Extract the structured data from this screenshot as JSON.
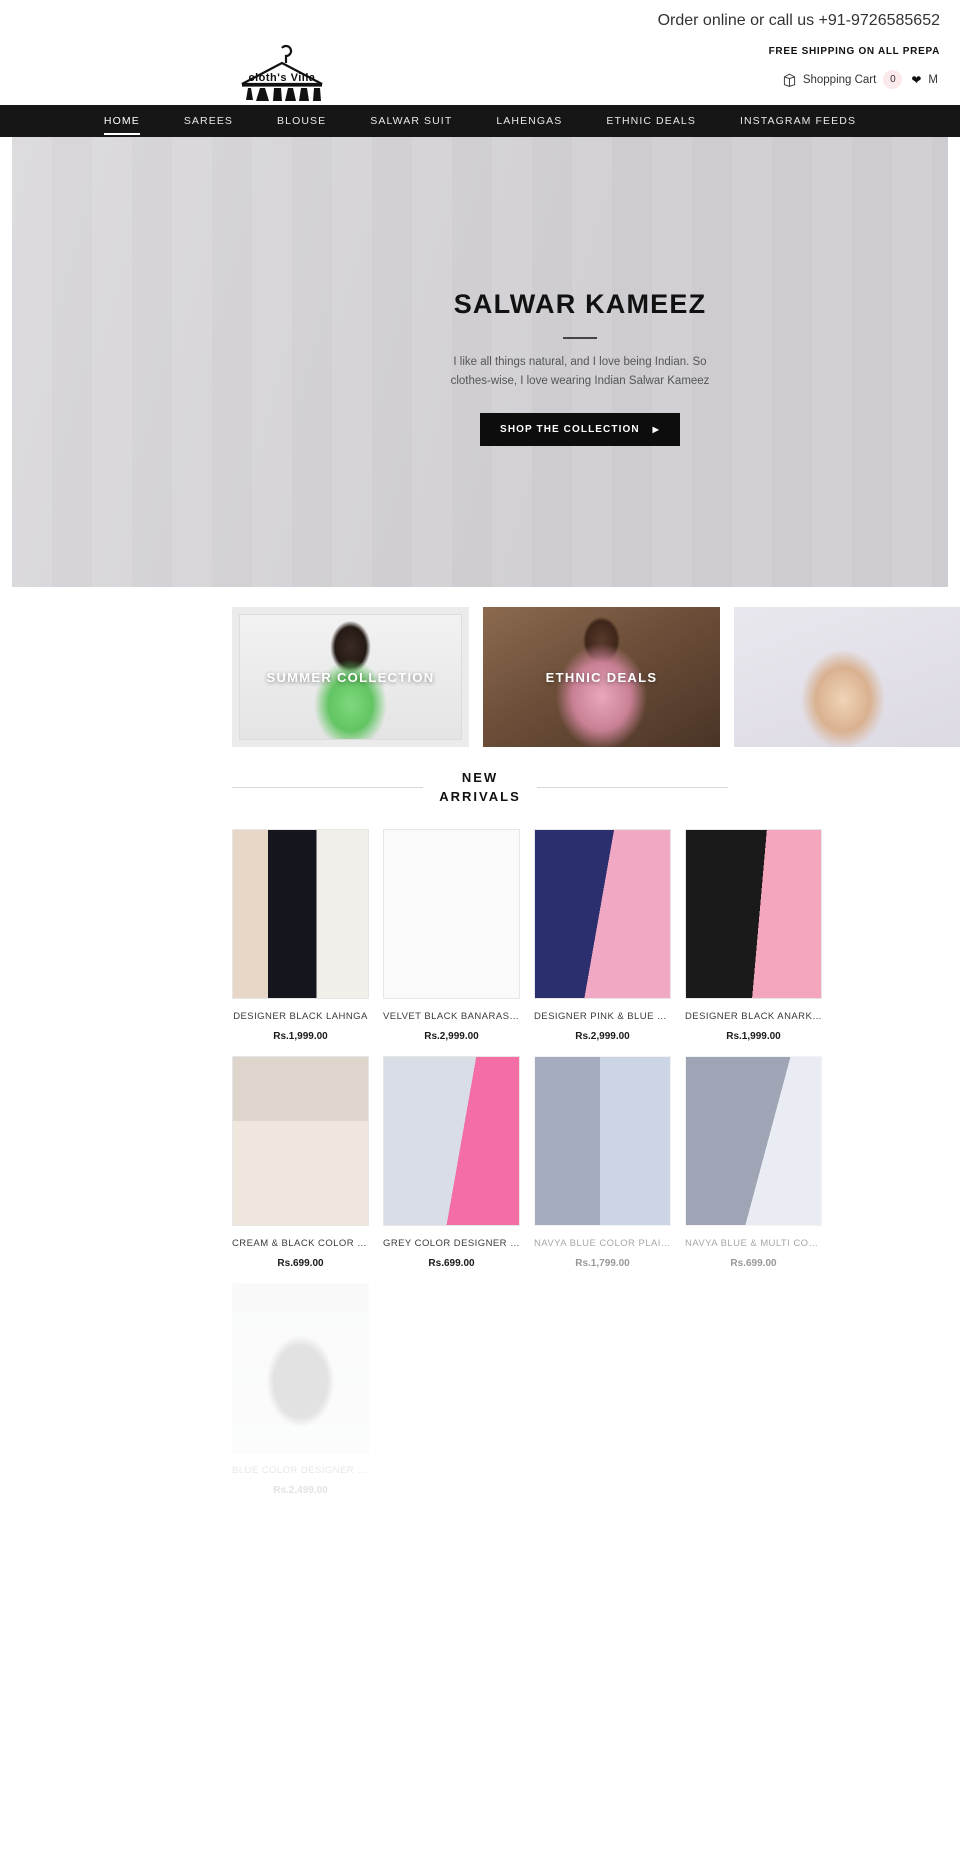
{
  "topbar": {
    "phone": "Order online or call us +91-9726585652",
    "shipping": "FREE SHIPPING ON ALL PREPA",
    "cart_label": "Shopping Cart",
    "cart_count": "0",
    "wishlist_label": "M"
  },
  "logo": {
    "text": "cloth's Villa"
  },
  "nav": {
    "items": [
      {
        "label": "HOME",
        "active": true
      },
      {
        "label": "SAREES",
        "active": false
      },
      {
        "label": "BLOUSE",
        "active": false
      },
      {
        "label": "SALWAR SUIT",
        "active": false
      },
      {
        "label": "LAHENGAS",
        "active": false
      },
      {
        "label": "ETHNIC DEALS",
        "active": false
      },
      {
        "label": "INSTAGRAM FEEDS",
        "active": false
      }
    ]
  },
  "hero": {
    "title": "SALWAR KAMEEZ",
    "subtitle": "I like all things natural, and I love being Indian. So clothes-wise, I love wearing Indian Salwar Kameez",
    "cta": "SHOP THE COLLECTION",
    "cta_arrow": "▶"
  },
  "tiles": [
    {
      "label": "SUMMER COLLECTION"
    },
    {
      "label": "ETHNIC DEALS"
    },
    {
      "label": ""
    }
  ],
  "section": {
    "title": "NEW\nARRIVALS"
  },
  "products": [
    {
      "title": "DESIGNER BLACK LAHNGA",
      "price": "Rs.1,999.00"
    },
    {
      "title": "VELVET BLACK BANARASI BROCA...",
      "price": "Rs.2,999.00"
    },
    {
      "title": "DESIGNER PINK & BLUE SEMIST...",
      "price": "Rs.2,999.00"
    },
    {
      "title": "DESIGNER BLACK ANARKALI",
      "price": "Rs.1,999.00"
    },
    {
      "title": "CREAM & BLACK COLOR DESIGNE...",
      "price": "Rs.699.00"
    },
    {
      "title": "GREY COLOR DESIGNER DRESS W...",
      "price": "Rs.699.00"
    },
    {
      "title": "NAVYA BLUE COLOR PLAIN GOWN...",
      "price": "Rs.1,799.00"
    },
    {
      "title": "NAVYA BLUE & MULTI COLOR",
      "price": "Rs.699.00"
    },
    {
      "title": "BLUE COLOR DESIGNER LEHENGA...",
      "price": "Rs.2,499.00"
    }
  ],
  "colors": {
    "nav_bg": "#161616",
    "hero_bg": "#d7d5d9",
    "accent": "#0d0d0d",
    "cart_badge": "#fbe9ec"
  }
}
